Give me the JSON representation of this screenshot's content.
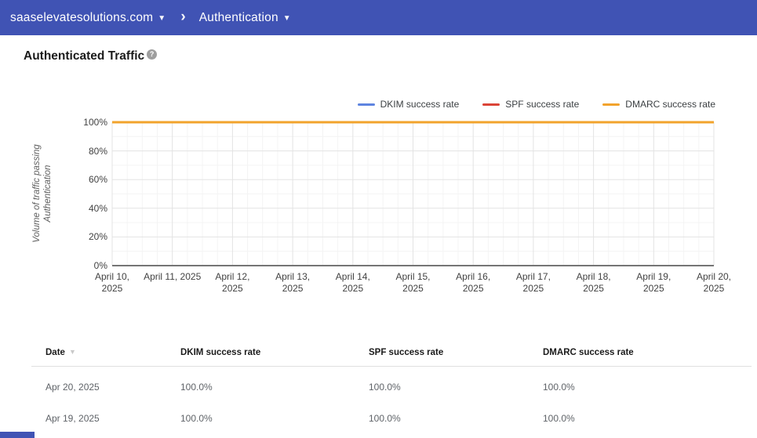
{
  "colors": {
    "topbar": "#4053b4",
    "grid_major": "#e3e3e3",
    "grid_minor": "#f4f4f4",
    "axis_line": "#757575"
  },
  "icons": {
    "dropdown_caret": "▼",
    "breadcrumb_chevron": "›",
    "sort_desc": "▼",
    "help": "?"
  },
  "header": {
    "domain": "saaselevatesolutions.com",
    "section": "Authentication"
  },
  "page": {
    "title": "Authenticated Traffic"
  },
  "chart_data": {
    "type": "line",
    "title": "Authenticated Traffic",
    "x": [
      "April 10, 2025",
      "April 11, 2025",
      "April 12, 2025",
      "April 13, 2025",
      "April 14, 2025",
      "April 15, 2025",
      "April 16, 2025",
      "April 17, 2025",
      "April 18, 2025",
      "April 19, 2025",
      "April 20, 2025"
    ],
    "x_tick_labels": [
      "April 10,\n2025",
      "April 11, 2025",
      "April 12,\n2025",
      "April 13,\n2025",
      "April 14,\n2025",
      "April 15,\n2025",
      "April 16,\n2025",
      "April 17,\n2025",
      "April 18,\n2025",
      "April 19,\n2025",
      "April 20,\n2025"
    ],
    "series": [
      {
        "name": "DKIM success rate",
        "color": "#5e84e0",
        "values": [
          100,
          100,
          100,
          100,
          100,
          100,
          100,
          100,
          100,
          100,
          100
        ]
      },
      {
        "name": "SPF success rate",
        "color": "#db4437",
        "values": [
          100,
          100,
          100,
          100,
          100,
          100,
          100,
          100,
          100,
          100,
          100
        ]
      },
      {
        "name": "DMARC success rate",
        "color": "#f2a32c",
        "values": [
          100,
          100,
          100,
          100,
          100,
          100,
          100,
          100,
          100,
          100,
          100
        ]
      }
    ],
    "ylabel": "Volume of traffic passing\nAuthentication",
    "y_ticks": [
      "100%",
      "80%",
      "60%",
      "40%",
      "20%",
      "0%"
    ],
    "ylim": [
      0,
      100
    ],
    "grid": true,
    "legend_position": "top-right"
  },
  "table": {
    "columns": [
      "Date",
      "DKIM success rate",
      "SPF success rate",
      "DMARC success rate"
    ],
    "rows": [
      [
        "Apr 20, 2025",
        "100.0%",
        "100.0%",
        "100.0%"
      ],
      [
        "Apr 19, 2025",
        "100.0%",
        "100.0%",
        "100.0%"
      ]
    ]
  }
}
